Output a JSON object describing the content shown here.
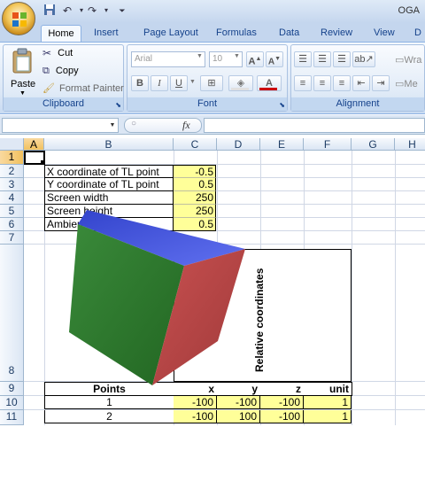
{
  "titlebar": {
    "title": "OGA"
  },
  "tabs": [
    "Home",
    "Insert",
    "Page Layout",
    "Formulas",
    "Data",
    "Review",
    "View",
    "D"
  ],
  "ribbon": {
    "clipboard": {
      "paste": "Paste",
      "cut": "Cut",
      "copy": "Copy",
      "format_painter": "Format Painter",
      "label": "Clipboard"
    },
    "font": {
      "name": "Arial",
      "size": "10",
      "label": "Font",
      "bold": "B",
      "italic": "I",
      "underline": "U"
    },
    "alignment": {
      "label": "Alignment",
      "wrap": "Wra",
      "merge": "Me"
    }
  },
  "formula_bar": {
    "fx": "fx",
    "name_box": "",
    "formula": ""
  },
  "columns": [
    "A",
    "B",
    "C",
    "D",
    "E",
    "F",
    "G",
    "H"
  ],
  "rows": [
    "1",
    "2",
    "3",
    "4",
    "5",
    "6",
    "7",
    "8",
    "9",
    "10",
    "11"
  ],
  "params": [
    {
      "label": "X coordinate of TL point",
      "value": "-0.5"
    },
    {
      "label": "Y coordinate of TL point",
      "value": "0.5"
    },
    {
      "label": "Screen width",
      "value": "250"
    },
    {
      "label": "Screen height",
      "value": "250"
    },
    {
      "label": "Ambien",
      "value": "0.5"
    }
  ],
  "chart_label": "Relative coordinates",
  "table": {
    "headers": [
      "Points",
      "x",
      "y",
      "z",
      "unit"
    ],
    "rows": [
      {
        "point": "1",
        "x": "-100",
        "y": "-100",
        "z": "-100",
        "unit": "1"
      },
      {
        "point": "2",
        "x": "-100",
        "y": "100",
        "z": "-100",
        "unit": "1"
      }
    ]
  },
  "colors": {
    "accent": "#15428b",
    "input_fill": "#ffff99",
    "cube_top": "#4a5ee8",
    "cube_left": "#2e7d2e",
    "cube_right": "#c04848"
  }
}
